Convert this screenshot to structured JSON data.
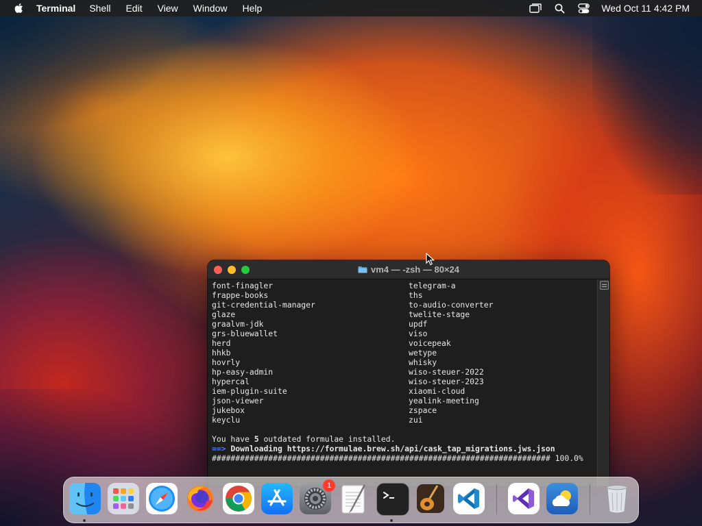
{
  "menubar": {
    "app_name": "Terminal",
    "items": [
      "Shell",
      "Edit",
      "View",
      "Window",
      "Help"
    ],
    "clock": "Wed Oct 11  4:42 PM",
    "status_icons": [
      "screen-mirroring-icon",
      "search-icon",
      "control-center-icon"
    ]
  },
  "terminal": {
    "title": "vm4 — -zsh — 80×24",
    "left_column": [
      "font-finagler",
      "frappe-books",
      "git-credential-manager",
      "glaze",
      "graalvm-jdk",
      "grs-bluewallet",
      "herd",
      "hhkb",
      "hovrly",
      "hp-easy-admin",
      "hypercal",
      "iem-plugin-suite",
      "json-viewer",
      "jukebox",
      "keyclu"
    ],
    "right_column": [
      "telegram-a",
      "ths",
      "to-audio-converter",
      "twelite-stage",
      "updf",
      "viso",
      "voicepeak",
      "wetype",
      "whisky",
      "wiso-steuer-2022",
      "wiso-steuer-2023",
      "xiaomi-cloud",
      "yealink-meeting",
      "zspace",
      "zui"
    ],
    "outdated_prefix": "You have ",
    "outdated_count": "5",
    "outdated_suffix": " outdated formulae installed.",
    "download_arrow": "==>",
    "download_text": " Downloading https://formulae.brew.sh/api/cask_tap_migrations.jws.json",
    "progress_bar": "######################################################################## 100.0%",
    "progress_percent": 100.0
  },
  "dock": {
    "apps": [
      {
        "name": "Finder",
        "icon": "finder-icon",
        "running": true
      },
      {
        "name": "Launchpad",
        "icon": "launchpad-icon",
        "running": false
      },
      {
        "name": "Safari",
        "icon": "safari-icon",
        "running": false
      },
      {
        "name": "Firefox",
        "icon": "firefox-icon",
        "running": false
      },
      {
        "name": "Google Chrome",
        "icon": "chrome-icon",
        "running": false
      },
      {
        "name": "App Store",
        "icon": "app-store-icon",
        "running": false
      },
      {
        "name": "System Settings",
        "icon": "system-settings-icon",
        "running": false,
        "badge": "1"
      },
      {
        "name": "TextEdit",
        "icon": "textedit-icon",
        "running": false
      },
      {
        "name": "Terminal",
        "icon": "terminal-icon",
        "running": true
      },
      {
        "name": "GarageBand",
        "icon": "garageband-icon",
        "running": false
      },
      {
        "name": "Visual Studio Code",
        "icon": "vscode-icon",
        "running": false
      },
      {
        "name": "Visual Studio",
        "icon": "visual-studio-icon",
        "running": false
      },
      {
        "name": "Weather",
        "icon": "weather-icon",
        "running": false
      },
      {
        "name": "Trash",
        "icon": "trash-icon",
        "running": false
      }
    ]
  }
}
